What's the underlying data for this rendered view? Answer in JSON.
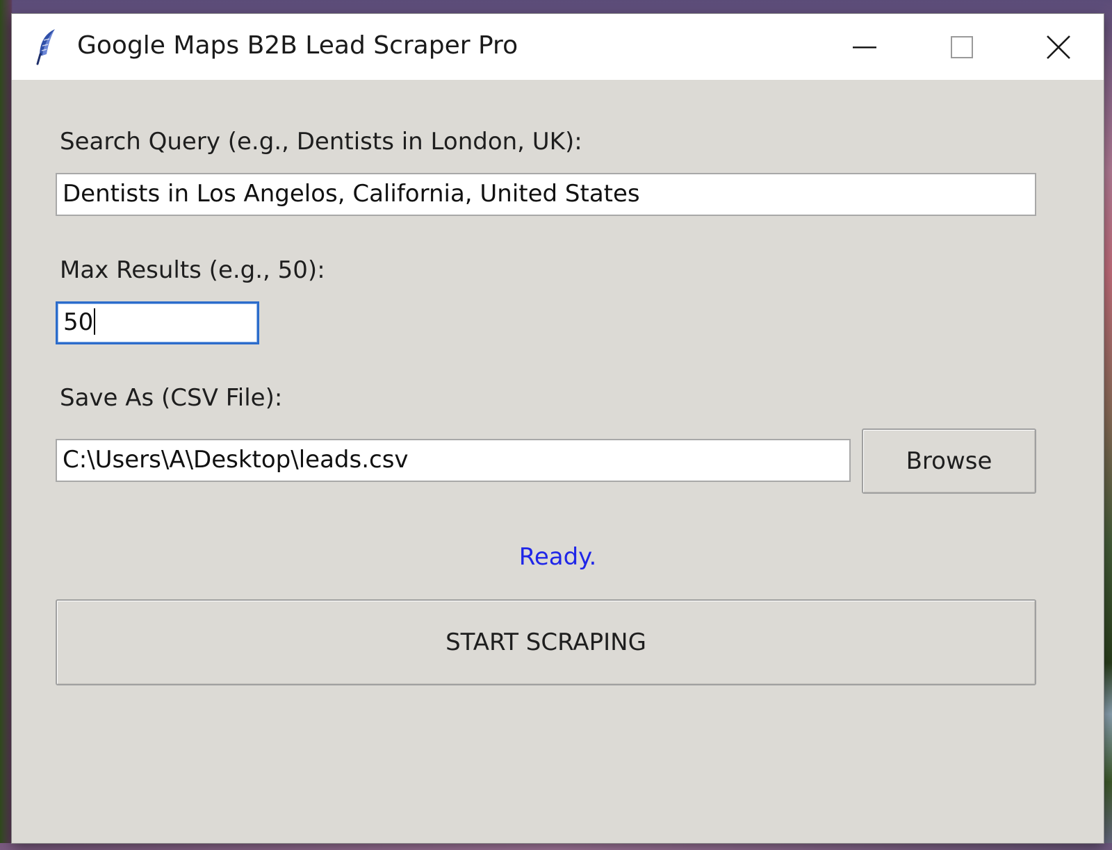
{
  "window": {
    "title": "Google Maps B2B Lead Scraper Pro",
    "icon": "feather-icon"
  },
  "form": {
    "query_label": "Search Query (e.g., Dentists in London, UK):",
    "query_value": "Dentists in Los Angelos, California, United States",
    "max_label": "Max Results (e.g., 50):",
    "max_value": "50",
    "save_label": "Save As (CSV File):",
    "save_value": "C:\\Users\\A\\Desktop\\leads.csv",
    "browse_label": "Browse"
  },
  "status": {
    "text": "Ready.",
    "color": "#1f26e8"
  },
  "actions": {
    "start_label": "START SCRAPING"
  }
}
